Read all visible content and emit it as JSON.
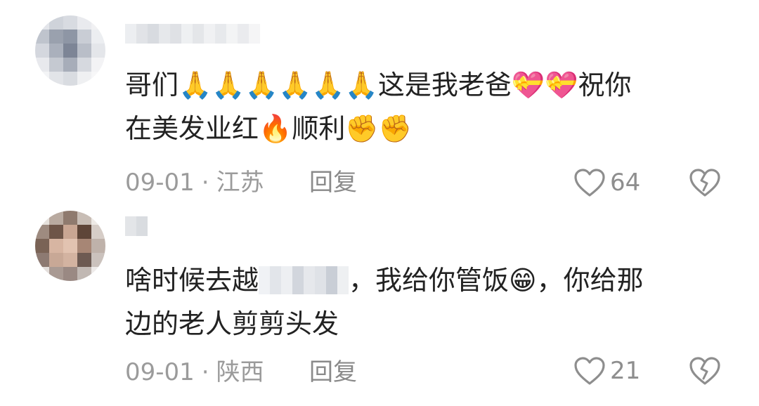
{
  "comments": [
    {
      "line1": "哥们🙏🙏🙏🙏🙏🙏这是我老爸💝💝祝你",
      "line2": "在美发业红🔥顺利✊✊",
      "date": "09-01",
      "separator": "·",
      "location": "江苏",
      "reply_label": "回复",
      "likes": "64"
    },
    {
      "line1_a": "啥时候去越",
      "line1_b": "，我给你管饭😁，你给那",
      "line2": "边的老人剪剪头发",
      "date": "09-01",
      "separator": "·",
      "location": "陕西",
      "reply_label": "回复",
      "likes": "21"
    }
  ],
  "icons": {
    "like": "heart-outline-icon",
    "dislike": "broken-heart-icon"
  },
  "colors": {
    "text": "#222222",
    "meta": "#9b9b9b",
    "icon": "#8e8e8e"
  }
}
